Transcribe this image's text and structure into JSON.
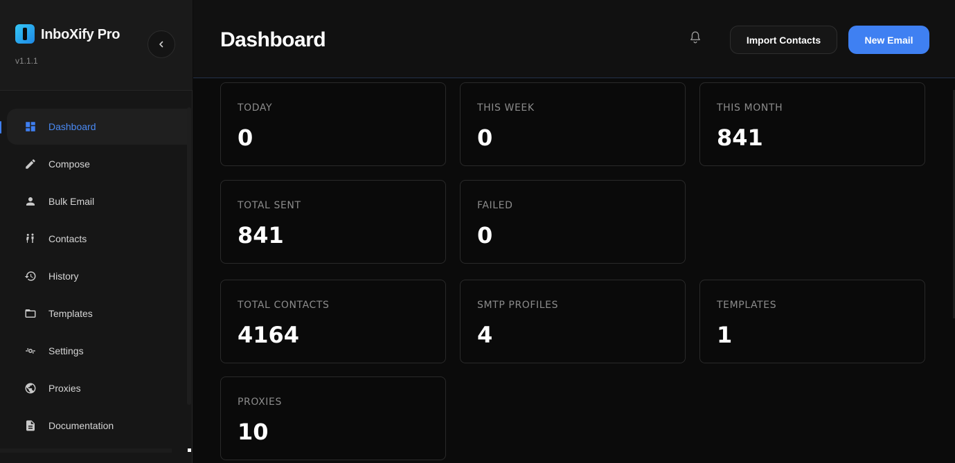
{
  "app": {
    "name": "InboXify Pro",
    "version": "v1.1.1"
  },
  "sidebar": {
    "items": [
      {
        "label": "Dashboard",
        "icon": "dashboard-icon",
        "active": true
      },
      {
        "label": "Compose",
        "icon": "pencil-icon"
      },
      {
        "label": "Bulk Email",
        "icon": "person-icon"
      },
      {
        "label": "Contacts",
        "icon": "people-icon"
      },
      {
        "label": "History",
        "icon": "history-icon"
      },
      {
        "label": "Templates",
        "icon": "folder-icon"
      },
      {
        "label": "Settings",
        "icon": "settings-icon"
      },
      {
        "label": "Proxies",
        "icon": "globe-icon"
      },
      {
        "label": "Documentation",
        "icon": "document-icon"
      }
    ]
  },
  "header": {
    "title": "Dashboard",
    "import_label": "Import Contacts",
    "new_email_label": "New Email"
  },
  "stats": [
    {
      "label": "TODAY",
      "value": "0"
    },
    {
      "label": "THIS WEEK",
      "value": "0"
    },
    {
      "label": "THIS MONTH",
      "value": "841"
    },
    {
      "label": "TOTAL SENT",
      "value": "841"
    },
    {
      "label": "FAILED",
      "value": "0"
    },
    {
      "label": "TOTAL CONTACTS",
      "value": "4164"
    },
    {
      "label": "SMTP PROFILES",
      "value": "4"
    },
    {
      "label": "TEMPLATES",
      "value": "1"
    },
    {
      "label": "PROXIES",
      "value": "10"
    }
  ],
  "colors": {
    "accent": "#3f80f2",
    "background": "#0b0b0b",
    "sidebar": "#161616"
  }
}
